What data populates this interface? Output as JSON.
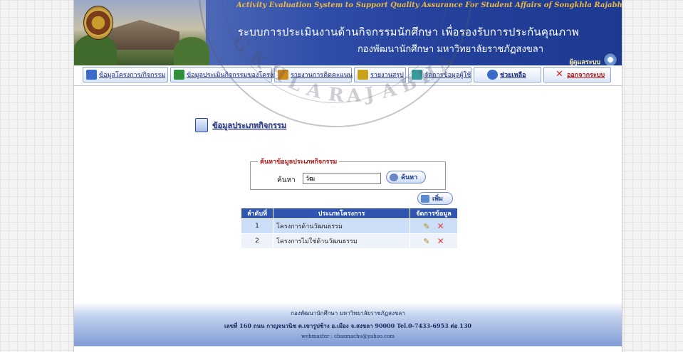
{
  "header": {
    "title_en": "Activity Evaluation  System to Support Quality  Assurance  For  Student  Affairs of Songkhla  Rajabhat  University",
    "title_th": "ระบบการประเมินงานด้านกิจกรรมนักศึกษา  เพื่อรองรับการประกันคุณภาพ",
    "subtitle_th": "กองพัฒนานักศึกษา  มหาวิทยาลัยราชภัฏสงขลา",
    "admin_label": "ผู้ดูแลระบบ"
  },
  "nav": {
    "items": [
      {
        "label": "ข้อมูลโครงการ/กิจกรรม",
        "icon": "monitor-icon",
        "color": "#3a6bc9"
      },
      {
        "label": "ข้อมูลประเมินกิจกรรมของโครงการ",
        "icon": "chart-icon",
        "color": "#2f8f3a"
      },
      {
        "label": "รายงานการคิดคะแนน",
        "icon": "document-icon",
        "color": "#d08a1a"
      },
      {
        "label": "รายงานสรุป",
        "icon": "report-icon",
        "color": "#c9a21a"
      },
      {
        "label": "จัดการข้อมูลผู้ใช้",
        "icon": "users-icon",
        "color": "#3a9a9a"
      },
      {
        "label": "ช่วยเหลือ",
        "icon": "help-icon",
        "color": "#3a6bc9"
      },
      {
        "label": "ออกจากระบบ",
        "icon": "close-icon",
        "color": "#d02020"
      }
    ]
  },
  "page": {
    "heading": "ข้อมูลประเภทกิจกรรม"
  },
  "search": {
    "legend": "ค้นหาข้อมูลประเภทกิจกรรม",
    "label": "ค้นหา",
    "value": "วัฒ",
    "button": "ค้นหา"
  },
  "add_button": "เพิ่ม",
  "table": {
    "headers": [
      "ลำดับที่",
      "ประเภทโครงการ",
      "จัดการข้อมูล"
    ],
    "rows": [
      {
        "no": "1",
        "name": "โครงการด้านวัฒนธรรม"
      },
      {
        "no": "2",
        "name": "โครงการไม่ใช่ด้านวัฒนธรรม"
      }
    ]
  },
  "footer": {
    "line1": "กองพัฒนานักศึกษา มหาวิทยาลัยราชภัฏสงขลา",
    "line2": "เลขที่ 160 ถนน กาญจนวนิช ต.เขารูปช้าง อ.เมือง จ.สงขลา 90000 Tel.0-7433-6953 ต่อ 130",
    "line3": "webmaster : chasmachu@yahoo.com"
  },
  "watermark": {
    "text": "SONGKHLA RAJABHAT"
  }
}
